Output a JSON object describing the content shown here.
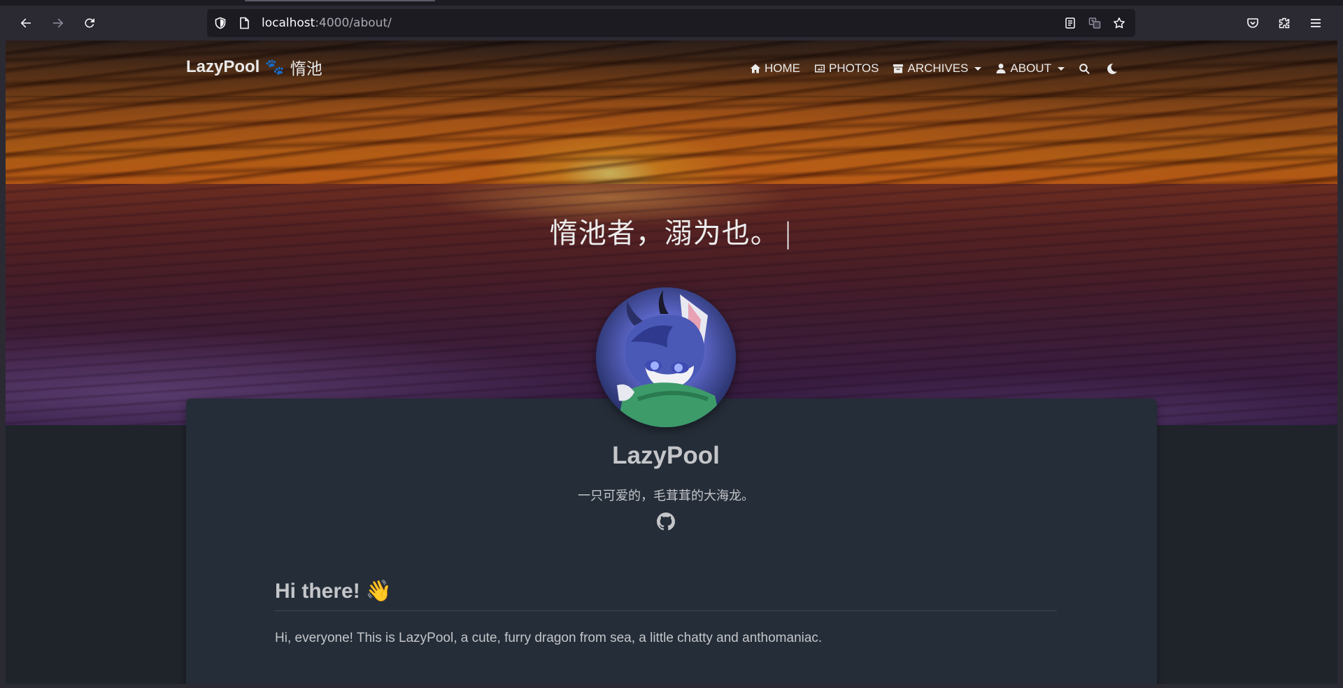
{
  "browser": {
    "url_host": "localhost",
    "url_path": ":4000/about/"
  },
  "site": {
    "brand_name": "LazyPool",
    "brand_paw": "🐾",
    "brand_cn": "惰池",
    "nav": [
      {
        "label": "HOME",
        "icon": "home-icon"
      },
      {
        "label": "PHOTOS",
        "icon": "image-icon"
      },
      {
        "label": "ARCHIVES",
        "icon": "archive-icon",
        "dropdown": true
      },
      {
        "label": "ABOUT",
        "icon": "user-icon",
        "dropdown": true
      }
    ],
    "slogan": "惰池者，溺为也。",
    "slogan_cursor": "|"
  },
  "about": {
    "name": "LazyPool",
    "bio": "一只可爱的，毛茸茸的大海龙。",
    "heading": "Hi there!",
    "heading_emoji": "👋",
    "intro": "Hi, everyone! This is LazyPool, a cute, furry dragon from sea, a little chatty and anthomaniac."
  },
  "colors": {
    "page_bg": "#1f242b",
    "card_bg": "#252d38",
    "text": "#c4c6c9",
    "brand_paw": "#5aa6e8"
  }
}
